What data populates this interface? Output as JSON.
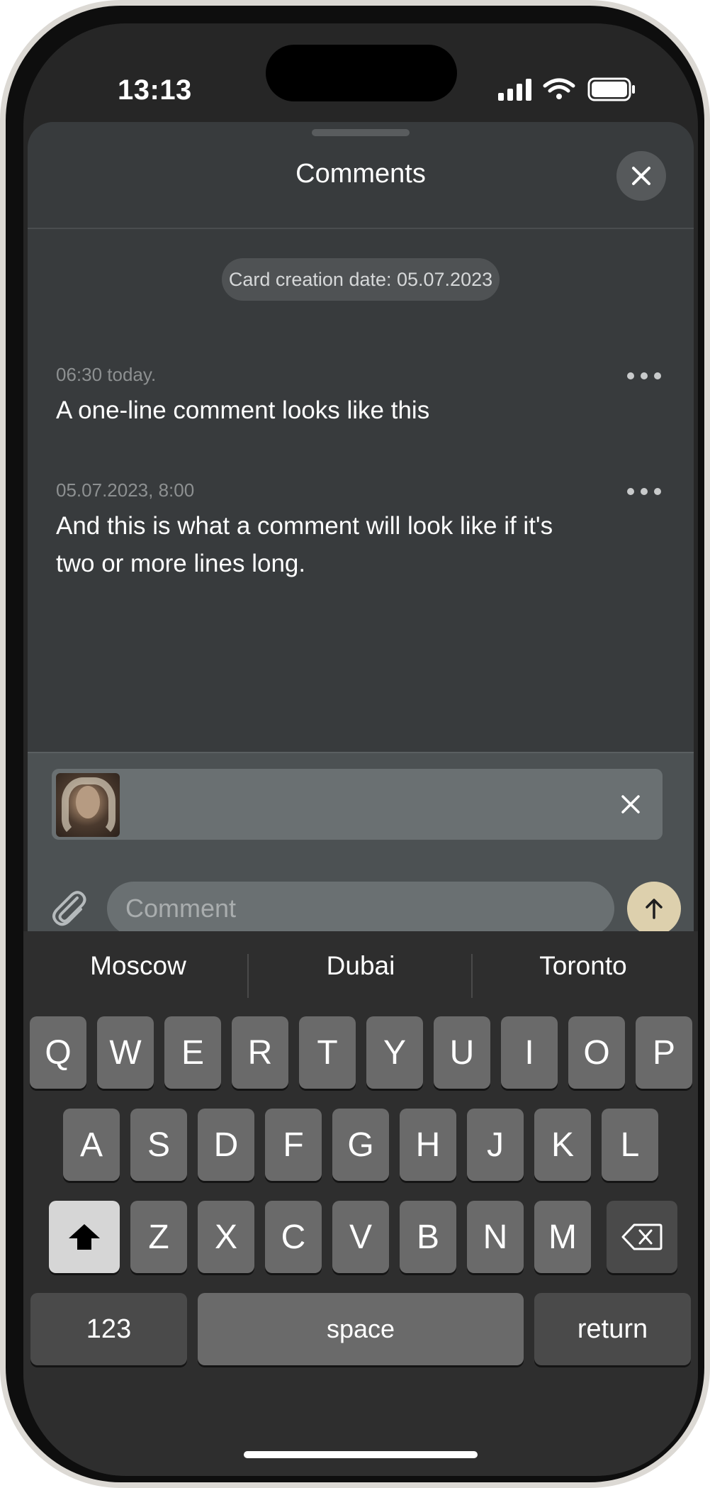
{
  "status_bar": {
    "time": "13:13"
  },
  "sheet": {
    "title": "Comments",
    "card_creation_label": "Card creation date: 05.07.2023"
  },
  "comments": [
    {
      "time": "06:30 today.",
      "text": "A one-line comment looks like this"
    },
    {
      "time": "05.07.2023, 8:00",
      "text": "And this is what a comment will look like if it's two or more lines long."
    }
  ],
  "composer": {
    "placeholder": "Comment",
    "value": ""
  },
  "keyboard": {
    "suggestions": [
      "Moscow",
      "Dubai",
      "Toronto"
    ],
    "row1": [
      "Q",
      "W",
      "E",
      "R",
      "T",
      "Y",
      "U",
      "I",
      "O",
      "P"
    ],
    "row2": [
      "A",
      "S",
      "D",
      "F",
      "G",
      "H",
      "J",
      "K",
      "L"
    ],
    "row3": [
      "Z",
      "X",
      "C",
      "V",
      "B",
      "N",
      "M"
    ],
    "numbers_label": "123",
    "space_label": "space",
    "return_label": "return"
  },
  "icons": {
    "close": "close-icon",
    "more": "more-horizontal-icon",
    "paperclip": "paperclip-icon",
    "send": "arrow-up-icon",
    "shift": "shift-icon",
    "backspace": "backspace-icon"
  },
  "colors": {
    "sheet_background": "#383b3d",
    "composer_background": "#4c5153",
    "send_button": "#ddd0ad",
    "keyboard_background": "#2e2e2e"
  }
}
